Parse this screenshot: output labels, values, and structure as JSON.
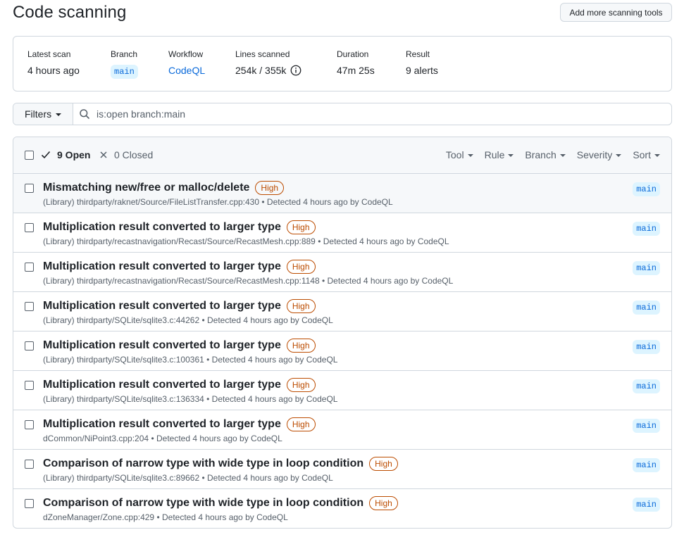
{
  "page": {
    "title": "Code scanning",
    "add_tools_label": "Add more scanning tools"
  },
  "summary": [
    {
      "label": "Latest scan",
      "value": "4 hours ago",
      "kind": "text"
    },
    {
      "label": "Branch",
      "value": "main",
      "kind": "chip"
    },
    {
      "label": "Workflow",
      "value": "CodeQL",
      "kind": "link"
    },
    {
      "label": "Lines scanned",
      "value": "254k / 355k",
      "kind": "info"
    },
    {
      "label": "Duration",
      "value": "47m 25s",
      "kind": "text"
    },
    {
      "label": "Result",
      "value": "9 alerts",
      "kind": "text"
    }
  ],
  "filters": {
    "label": "Filters",
    "query": "is:open branch:main",
    "search_icon": "search-icon"
  },
  "list_header": {
    "open_label": "9 Open",
    "closed_label": "0 Closed",
    "sort_menus": [
      "Tool",
      "Rule",
      "Branch",
      "Severity",
      "Sort"
    ]
  },
  "alerts": [
    {
      "title": "Mismatching new/free or malloc/delete",
      "severity": "High",
      "library": "(Library)",
      "path": "thirdparty/raknet/Source/FileListTransfer.cpp:430",
      "detected": "• Detected 4 hours ago by CodeQL",
      "branch": "main"
    },
    {
      "title": "Multiplication result converted to larger type",
      "severity": "High",
      "library": "(Library)",
      "path": "thirdparty/recastnavigation/Recast/Source/RecastMesh.cpp:889",
      "detected": "• Detected 4 hours ago by CodeQL",
      "branch": "main"
    },
    {
      "title": "Multiplication result converted to larger type",
      "severity": "High",
      "library": "(Library)",
      "path": "thirdparty/recastnavigation/Recast/Source/RecastMesh.cpp:1148",
      "detected": "• Detected 4 hours ago by CodeQL",
      "branch": "main"
    },
    {
      "title": "Multiplication result converted to larger type",
      "severity": "High",
      "library": "(Library)",
      "path": "thirdparty/SQLite/sqlite3.c:44262",
      "detected": "• Detected 4 hours ago by CodeQL",
      "branch": "main"
    },
    {
      "title": "Multiplication result converted to larger type",
      "severity": "High",
      "library": "(Library)",
      "path": "thirdparty/SQLite/sqlite3.c:100361",
      "detected": "• Detected 4 hours ago by CodeQL",
      "branch": "main"
    },
    {
      "title": "Multiplication result converted to larger type",
      "severity": "High",
      "library": "(Library)",
      "path": "thirdparty/SQLite/sqlite3.c:136334",
      "detected": "• Detected 4 hours ago by CodeQL",
      "branch": "main"
    },
    {
      "title": "Multiplication result converted to larger type",
      "severity": "High",
      "library": "",
      "path": "dCommon/NiPoint3.cpp:204",
      "detected": "• Detected 4 hours ago by CodeQL",
      "branch": "main"
    },
    {
      "title": "Comparison of narrow type with wide type in loop condition",
      "severity": "High",
      "library": "(Library)",
      "path": "thirdparty/SQLite/sqlite3.c:89662",
      "detected": "• Detected 4 hours ago by CodeQL",
      "branch": "main"
    },
    {
      "title": "Comparison of narrow type with wide type in loop condition",
      "severity": "High",
      "library": "",
      "path": "dZoneManager/Zone.cpp:429",
      "detected": "• Detected 4 hours ago by CodeQL",
      "branch": "main"
    }
  ],
  "colors": {
    "accent": "#0969da",
    "severity_high": "#bc4c00",
    "border": "#d0d7de",
    "muted": "#57606a"
  }
}
